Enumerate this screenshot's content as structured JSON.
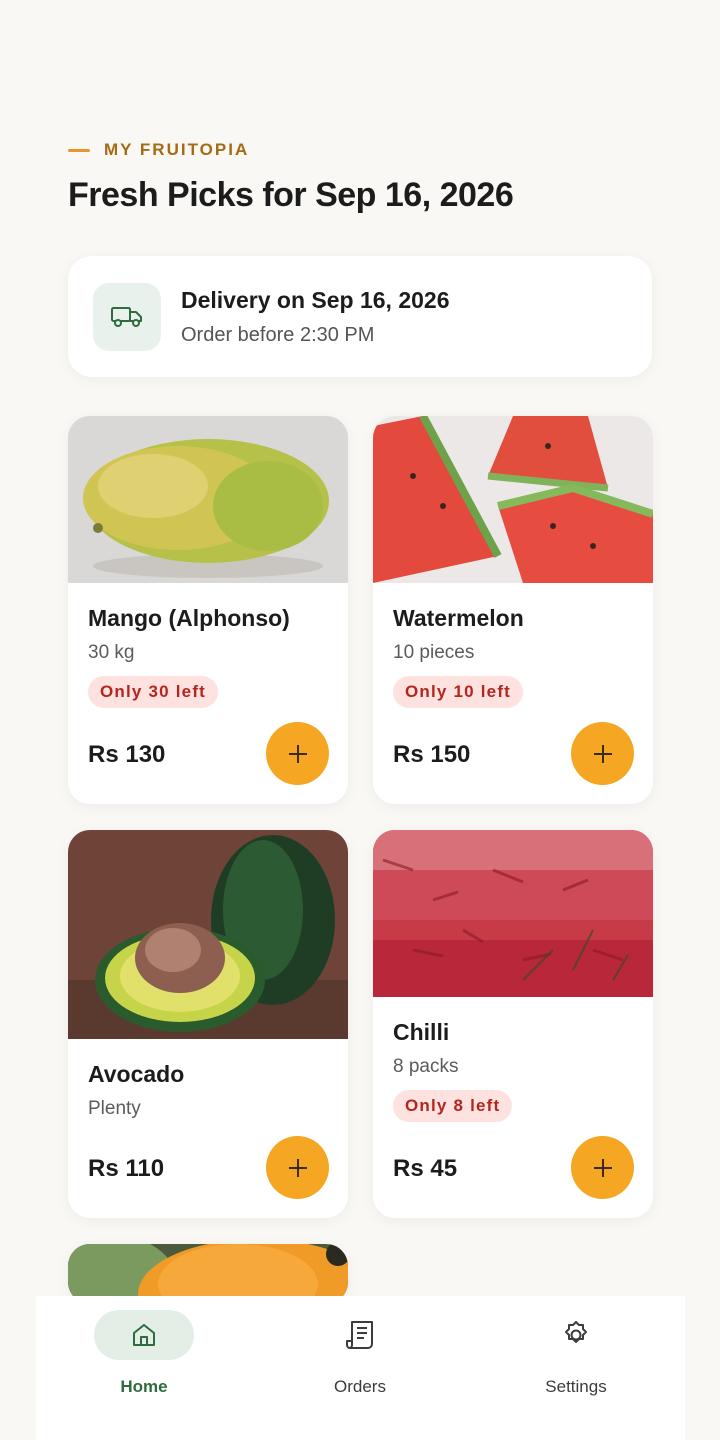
{
  "header": {
    "eyebrow": "MY FRUITOPIA",
    "title": "Fresh Picks for Sep 16, 2026"
  },
  "delivery": {
    "icon": "truck-icon",
    "title": "Delivery on Sep 16, 2026",
    "subtitle": "Order before 2:30 PM"
  },
  "products": [
    {
      "name": "Mango (Alphonso)",
      "qty": "30 kg",
      "badge": "Only 30 left",
      "price": "Rs 130"
    },
    {
      "name": "Watermelon",
      "qty": "10 pieces",
      "badge": "Only 10 left",
      "price": "Rs 150"
    },
    {
      "name": "Avocado",
      "qty": "Plenty",
      "price": "Rs 110"
    },
    {
      "name": "Chilli",
      "qty": "8 packs",
      "badge": "Only 8 left",
      "price": "Rs 45"
    }
  ],
  "nav": [
    {
      "label": "Home",
      "icon": "home-icon",
      "active": true
    },
    {
      "label": "Orders",
      "icon": "receipt-icon",
      "active": false
    },
    {
      "label": "Settings",
      "icon": "gear-icon",
      "active": false
    }
  ],
  "colors": {
    "accent": "#f5a623",
    "primary": "#2e6b3f",
    "badge_bg": "#fde2e0",
    "badge_text": "#b3261e",
    "background": "#f9f8f4"
  }
}
